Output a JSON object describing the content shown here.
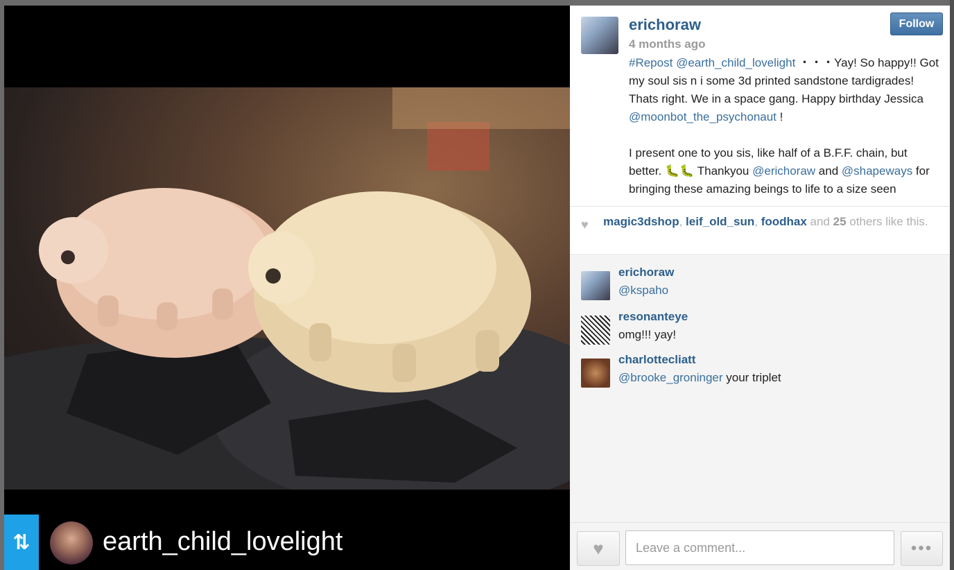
{
  "media": {
    "repost_badge_icon": "repost-icon",
    "repost_username": "earth_child_lovelight",
    "photo_alt": "two 3d printed tardigrade figurines"
  },
  "post": {
    "author": "erichoraw",
    "time": "4 months ago",
    "follow_label": "Follow",
    "caption": {
      "repost_tag": "#Repost",
      "mention1": "@earth_child_lovelight",
      "text1": " ・・・Yay! So happy!! Got my soul sis n i some 3d printed sandstone tardigrades! Thats right. We in a space gang. Happy birthday Jessica ",
      "mention2": "@moonbot_the_psychonaut",
      "text2": " !",
      "text3": "I present one to you sis, like half of a B.F.F. chain, but better. 🐛🐛 Thankyou ",
      "mention3": "@erichoraw",
      "text4": " and ",
      "mention4": "@shapeways",
      "text5": " for bringing these amazing beings to life to a size seen"
    }
  },
  "likes": {
    "user1": "magic3dshop",
    "user2": "leif_old_sun",
    "user3": "foodhax",
    "and": " and ",
    "count": "25",
    "suffix": " others like this."
  },
  "comments": [
    {
      "user": "erichoraw",
      "mention": "@kspaho",
      "text": ""
    },
    {
      "user": "resonanteye",
      "mention": "",
      "text": "omg!!! yay!"
    },
    {
      "user": "charlottecliatt",
      "mention": "@brooke_groninger",
      "text": " your triplet"
    }
  ],
  "compose": {
    "placeholder": "Leave a comment...",
    "more_label": "•••"
  },
  "colors": {
    "link": "#2d5f8b",
    "follow": "#3e70a3",
    "repost_badge": "#1ea1e6"
  }
}
